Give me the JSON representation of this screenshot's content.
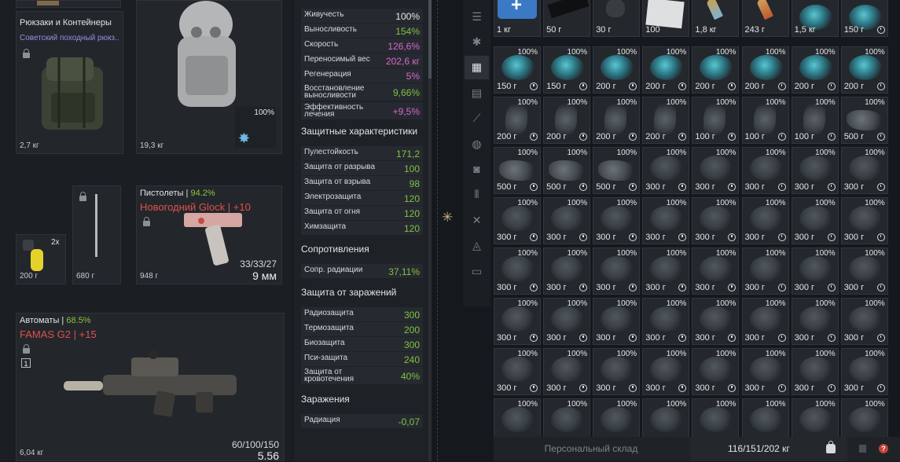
{
  "equipment": {
    "backpack": {
      "category": "Рюкзаки и Контейнеры",
      "name": "Советский походный рюкз..",
      "weight": "2,7 кг"
    },
    "armor": {
      "weight": "19,3 кг",
      "durability": "100%"
    },
    "grenade": {
      "count": "2x",
      "weight": "200 г"
    },
    "knife": {
      "weight": "680 г"
    },
    "pistol": {
      "category": "Пистолеты",
      "category_pct": "94.2%",
      "separator": "|",
      "name": "Новогодний Glock",
      "upgrade": "| +10",
      "weight": "948 г",
      "ammo": "33/33/27",
      "caliber": "9 мм"
    },
    "rifle": {
      "category": "Автоматы",
      "category_pct": "68.5%",
      "separator": "|",
      "name": "FAMAS G2",
      "upgrade": "| +15",
      "slot_number": "1",
      "weight": "6,04 кг",
      "ammo": "60/100/150",
      "caliber": "5.56"
    }
  },
  "stats": {
    "vitals": [
      {
        "label": "Живучесть",
        "value": "100%",
        "color": "#e6e8ea"
      },
      {
        "label": "Выносливость",
        "value": "154%",
        "color": "#7ec241"
      },
      {
        "label": "Скорость",
        "value": "126,6%",
        "color": "#d767c9"
      },
      {
        "label": "Переносимый вес",
        "value": "202,6 кг",
        "color": "#d767c9"
      },
      {
        "label": "Регенерация",
        "value": "5%",
        "color": "#d767c9"
      },
      {
        "label": "Восстановление выносливости",
        "value": "9,66%",
        "color": "#7ec241"
      },
      {
        "label": "Эффективность лечения",
        "value": "+9,5%",
        "color": "#d767c9"
      }
    ],
    "protection_title": "Защитные характеристики",
    "protection": [
      {
        "label": "Пулестойкость",
        "value": "171,2"
      },
      {
        "label": "Защита от разрыва",
        "value": "100"
      },
      {
        "label": "Защита от взрыва",
        "value": "98"
      },
      {
        "label": "Электрозащита",
        "value": "120"
      },
      {
        "label": "Защита от огня",
        "value": "120"
      },
      {
        "label": "Химзащита",
        "value": "120"
      }
    ],
    "resistance_title": "Сопротивления",
    "resistance": [
      {
        "label": "Сопр. радиации",
        "value": "37,11%"
      }
    ],
    "infection_protection_title": "Защита от заражений",
    "infection_protection": [
      {
        "label": "Радиозащита",
        "value": "300"
      },
      {
        "label": "Термозащита",
        "value": "200"
      },
      {
        "label": "Биозащита",
        "value": "300"
      },
      {
        "label": "Пси-защита",
        "value": "240"
      },
      {
        "label": "Защита от кровотечения",
        "value": "40%"
      }
    ],
    "infection_title": "Заражения",
    "infection": [
      {
        "label": "Радиация",
        "value": "-0,07"
      }
    ]
  },
  "categories": [
    {
      "icon": "list-icon",
      "glyph": "☰",
      "active": false
    },
    {
      "icon": "star-icon",
      "glyph": "✱",
      "active": false
    },
    {
      "icon": "grid-icon",
      "glyph": "▦",
      "active": true
    },
    {
      "icon": "armor-icon",
      "glyph": "▤",
      "active": false
    },
    {
      "icon": "knife-icon",
      "glyph": "⟋",
      "active": false
    },
    {
      "icon": "artifact-icon",
      "glyph": "◍",
      "active": false
    },
    {
      "icon": "camera-icon",
      "glyph": "◙",
      "active": false
    },
    {
      "icon": "ammo-icon",
      "glyph": "⦀",
      "active": false
    },
    {
      "icon": "tools-icon",
      "glyph": "✕",
      "active": false
    },
    {
      "icon": "misc-icon",
      "glyph": "◬",
      "active": false
    },
    {
      "icon": "box-icon",
      "glyph": "▭",
      "active": false
    }
  ],
  "stash": {
    "rows": [
      [
        {
          "icon": "medkit",
          "weight": "1 кг",
          "pct": "",
          "clock": false
        },
        {
          "icon": "black",
          "weight": "50 г",
          "pct": "",
          "clock": false
        },
        {
          "icon": "grenade",
          "weight": "30 г",
          "pct": "",
          "clock": false
        },
        {
          "icon": "paper",
          "weight": "100",
          "pct": "",
          "clock": false
        },
        {
          "icon": "bullet-blue",
          "weight": "1,8 кг",
          "pct": "",
          "clock": false
        },
        {
          "icon": "bullet-red",
          "weight": "243 г",
          "pct": "",
          "clock": false
        },
        {
          "icon": "teal",
          "weight": "1,5 кг",
          "pct": "",
          "clock": false
        },
        {
          "icon": "teal",
          "weight": "150 г",
          "pct": "",
          "clock": true
        }
      ],
      [
        {
          "icon": "teal",
          "weight": "150 г",
          "pct": "100%",
          "clock": true
        },
        {
          "icon": "teal",
          "weight": "150 г",
          "pct": "100%",
          "clock": true
        },
        {
          "icon": "teal",
          "weight": "200 г",
          "pct": "100%",
          "clock": true
        },
        {
          "icon": "teal",
          "weight": "200 г",
          "pct": "100%",
          "clock": true
        },
        {
          "icon": "teal",
          "weight": "200 г",
          "pct": "100%",
          "clock": true
        },
        {
          "icon": "teal",
          "weight": "200 г",
          "pct": "100%",
          "clock": true
        },
        {
          "icon": "teal",
          "weight": "200 г",
          "pct": "100%",
          "clock": true
        },
        {
          "icon": "teal",
          "weight": "200 г",
          "pct": "100%",
          "clock": true
        }
      ],
      [
        {
          "icon": "shard",
          "weight": "200 г",
          "pct": "100%",
          "clock": true
        },
        {
          "icon": "shard",
          "weight": "200 г",
          "pct": "100%",
          "clock": true
        },
        {
          "icon": "shard",
          "weight": "200 г",
          "pct": "100%",
          "clock": true
        },
        {
          "icon": "shard",
          "weight": "200 г",
          "pct": "100%",
          "clock": true
        },
        {
          "icon": "shard",
          "weight": "100 г",
          "pct": "100%",
          "clock": true
        },
        {
          "icon": "shard",
          "weight": "100 г",
          "pct": "100%",
          "clock": true
        },
        {
          "icon": "shard",
          "weight": "100 г",
          "pct": "100%",
          "clock": true
        },
        {
          "icon": "scrap",
          "weight": "500 г",
          "pct": "100%",
          "clock": true
        }
      ],
      [
        {
          "icon": "scrap",
          "weight": "500 г",
          "pct": "100%",
          "clock": true
        },
        {
          "icon": "scrap",
          "weight": "500 г",
          "pct": "100%",
          "clock": true
        },
        {
          "icon": "scrap",
          "weight": "500 г",
          "pct": "100%",
          "clock": true
        },
        {
          "icon": "blob",
          "weight": "300 г",
          "pct": "100%",
          "clock": true
        },
        {
          "icon": "blob",
          "weight": "300 г",
          "pct": "100%",
          "clock": true
        },
        {
          "icon": "blob",
          "weight": "300 г",
          "pct": "100%",
          "clock": true
        },
        {
          "icon": "blob",
          "weight": "300 г",
          "pct": "100%",
          "clock": true
        },
        {
          "icon": "blob",
          "weight": "300 г",
          "pct": "100%",
          "clock": true
        }
      ],
      [
        {
          "icon": "blob",
          "weight": "300 г",
          "pct": "100%",
          "clock": true
        },
        {
          "icon": "blob",
          "weight": "300 г",
          "pct": "100%",
          "clock": true
        },
        {
          "icon": "blob",
          "weight": "300 г",
          "pct": "100%",
          "clock": true
        },
        {
          "icon": "blob",
          "weight": "300 г",
          "pct": "100%",
          "clock": true
        },
        {
          "icon": "blob",
          "weight": "300 г",
          "pct": "100%",
          "clock": true
        },
        {
          "icon": "blob",
          "weight": "300 г",
          "pct": "100%",
          "clock": true
        },
        {
          "icon": "blob",
          "weight": "300 г",
          "pct": "100%",
          "clock": true
        },
        {
          "icon": "blob",
          "weight": "300 г",
          "pct": "100%",
          "clock": true
        }
      ],
      [
        {
          "icon": "blob",
          "weight": "300 г",
          "pct": "100%",
          "clock": true
        },
        {
          "icon": "blob",
          "weight": "300 г",
          "pct": "100%",
          "clock": true
        },
        {
          "icon": "blob",
          "weight": "300 г",
          "pct": "100%",
          "clock": true
        },
        {
          "icon": "blob",
          "weight": "300 г",
          "pct": "100%",
          "clock": true
        },
        {
          "icon": "blob",
          "weight": "300 г",
          "pct": "100%",
          "clock": true
        },
        {
          "icon": "blob",
          "weight": "300 г",
          "pct": "100%",
          "clock": true
        },
        {
          "icon": "blob",
          "weight": "300 г",
          "pct": "100%",
          "clock": true
        },
        {
          "icon": "blob",
          "weight": "300 г",
          "pct": "100%",
          "clock": true
        }
      ],
      [
        {
          "icon": "blob",
          "weight": "300 г",
          "pct": "100%",
          "clock": true
        },
        {
          "icon": "blob",
          "weight": "300 г",
          "pct": "100%",
          "clock": true
        },
        {
          "icon": "blob",
          "weight": "300 г",
          "pct": "100%",
          "clock": true
        },
        {
          "icon": "blob",
          "weight": "300 г",
          "pct": "100%",
          "clock": true
        },
        {
          "icon": "blob",
          "weight": "300 г",
          "pct": "100%",
          "clock": true
        },
        {
          "icon": "blob",
          "weight": "300 г",
          "pct": "100%",
          "clock": true
        },
        {
          "icon": "blob",
          "weight": "300 г",
          "pct": "100%",
          "clock": true
        },
        {
          "icon": "blob",
          "weight": "300 г",
          "pct": "100%",
          "clock": true
        }
      ],
      [
        {
          "icon": "blob",
          "weight": "300 г",
          "pct": "100%",
          "clock": true
        },
        {
          "icon": "blob",
          "weight": "300 г",
          "pct": "100%",
          "clock": true
        },
        {
          "icon": "blob",
          "weight": "300 г",
          "pct": "100%",
          "clock": true
        },
        {
          "icon": "blob",
          "weight": "300 г",
          "pct": "100%",
          "clock": true
        },
        {
          "icon": "blob",
          "weight": "300 г",
          "pct": "100%",
          "clock": true
        },
        {
          "icon": "blob",
          "weight": "300 г",
          "pct": "100%",
          "clock": true
        },
        {
          "icon": "blob",
          "weight": "300 г",
          "pct": "100%",
          "clock": true
        },
        {
          "icon": "blob",
          "weight": "300 г",
          "pct": "100%",
          "clock": true
        }
      ],
      [
        {
          "icon": "blob",
          "weight": "",
          "pct": "100%",
          "clock": false
        },
        {
          "icon": "blob",
          "weight": "",
          "pct": "100%",
          "clock": false
        },
        {
          "icon": "blob",
          "weight": "",
          "pct": "100%",
          "clock": false
        },
        {
          "icon": "blob",
          "weight": "",
          "pct": "100%",
          "clock": false
        },
        {
          "icon": "blob",
          "weight": "",
          "pct": "100%",
          "clock": false
        },
        {
          "icon": "blob",
          "weight": "",
          "pct": "100%",
          "clock": false
        },
        {
          "icon": "blob",
          "weight": "",
          "pct": "100%",
          "clock": false
        },
        {
          "icon": "blob",
          "weight": "",
          "pct": "100%",
          "clock": false
        }
      ]
    ]
  },
  "footer": {
    "stash_label": "Персональный склад",
    "capacity": "116/151/202 кг",
    "help": "?"
  }
}
